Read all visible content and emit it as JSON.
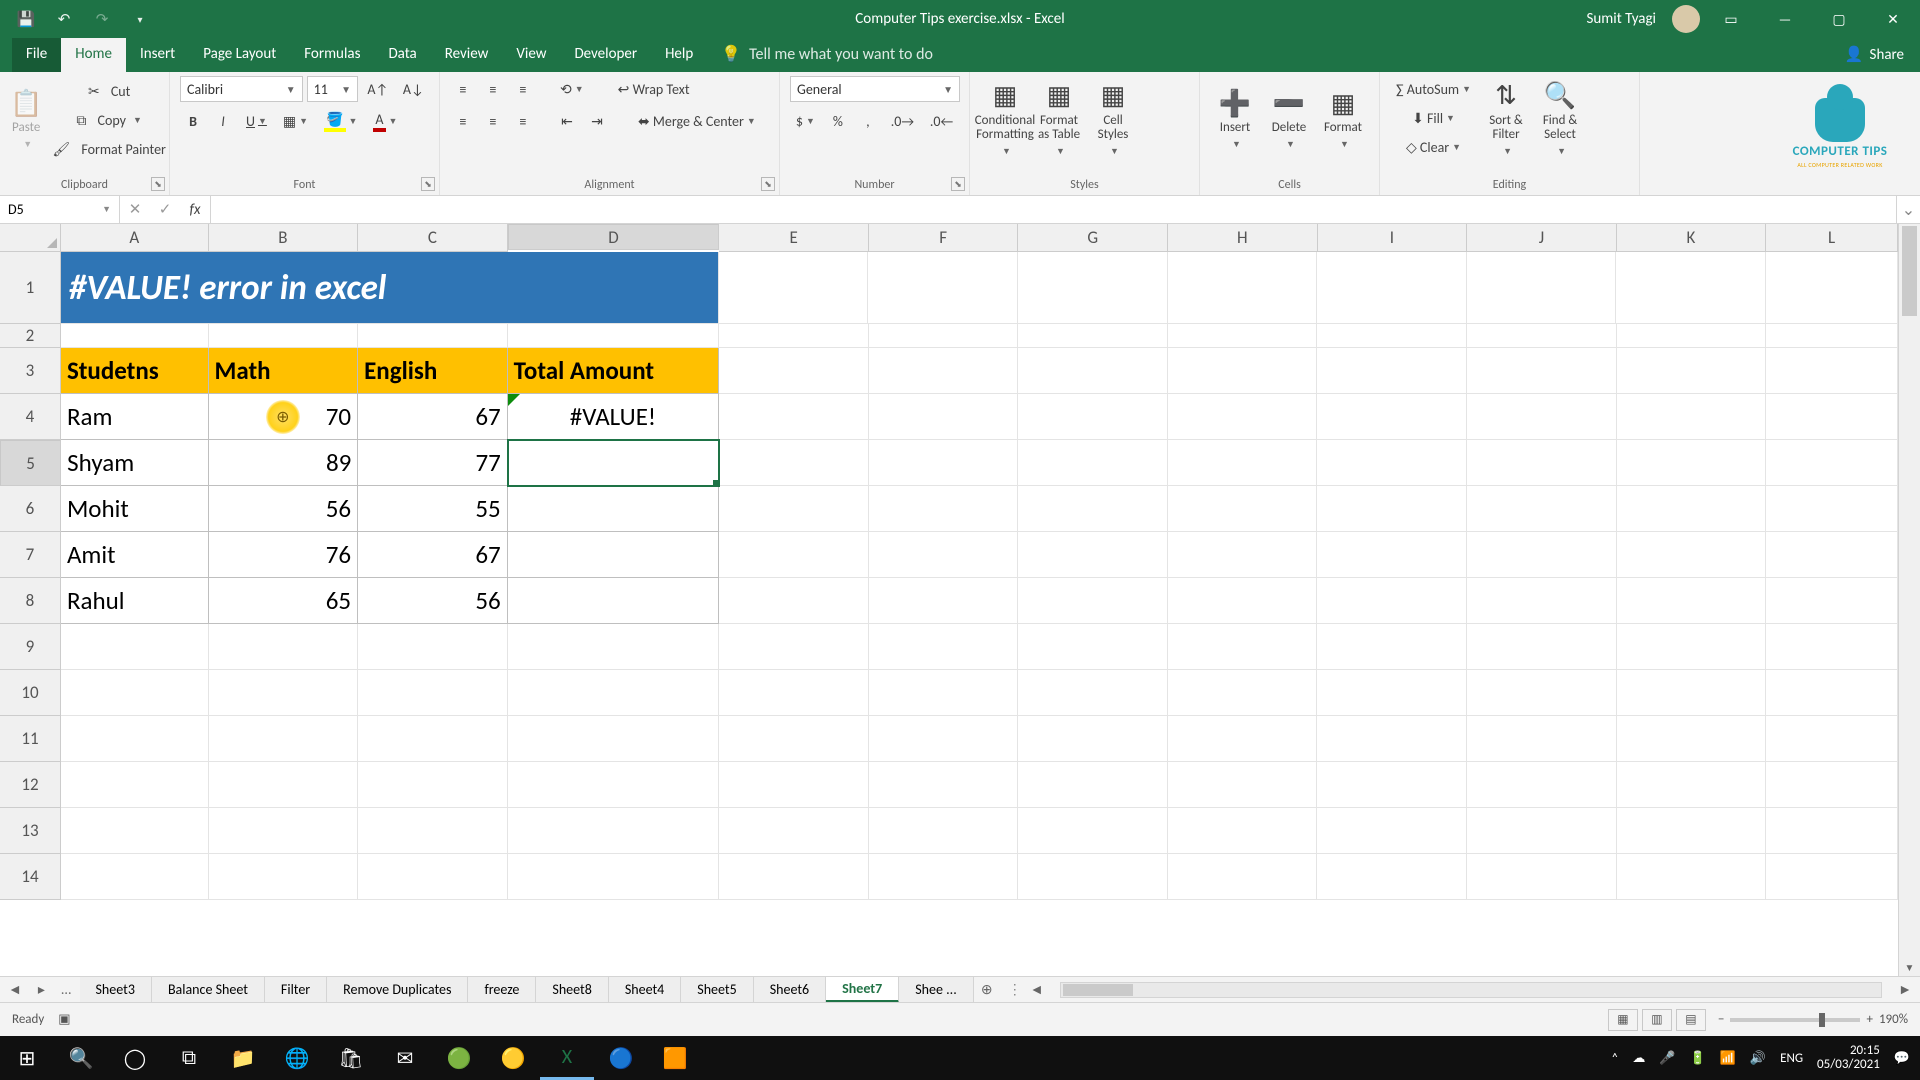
{
  "titlebar": {
    "doc_title": "Computer Tips exercise.xlsx - Excel",
    "user_name": "Sumit Tyagi"
  },
  "tabs": {
    "file": "File",
    "home": "Home",
    "insert": "Insert",
    "pagelayout": "Page Layout",
    "formulas": "Formulas",
    "data": "Data",
    "review": "Review",
    "view": "View",
    "developer": "Developer",
    "help": "Help",
    "tellme": "Tell me what you want to do",
    "share": "Share"
  },
  "ribbon": {
    "clipboard": {
      "paste": "Paste",
      "cut": "Cut",
      "copy": "Copy",
      "fmt": "Format Painter",
      "label": "Clipboard"
    },
    "font": {
      "name": "Calibri",
      "size": "11",
      "label": "Font"
    },
    "alignment": {
      "wrap": "Wrap Text",
      "merge": "Merge & Center",
      "label": "Alignment"
    },
    "number": {
      "fmt": "General",
      "label": "Number"
    },
    "styles": {
      "cond": "Conditional Formatting",
      "fat": "Format as Table",
      "cell": "Cell Styles",
      "label": "Styles"
    },
    "cells": {
      "ins": "Insert",
      "del": "Delete",
      "fmt": "Format",
      "label": "Cells"
    },
    "editing": {
      "sum": "AutoSum",
      "fill": "Fill",
      "clear": "Clear",
      "sort": "Sort & Filter",
      "find": "Find & Select",
      "label": "Editing"
    },
    "logo": {
      "line1": "COMPUTER TIPS",
      "line2": "ALL COMPUTER RELATED WORK"
    }
  },
  "fx": {
    "ref": "D5",
    "formula": ""
  },
  "cols": [
    "A",
    "B",
    "C",
    "D",
    "E",
    "F",
    "G",
    "H",
    "I",
    "J",
    "K",
    "L"
  ],
  "sheet": {
    "title": "#VALUE! error in excel",
    "headers": {
      "a": "Studetns",
      "b": "Math",
      "c": "English",
      "d": "Total Amount"
    },
    "rows": [
      {
        "a": "Ram",
        "b": "70",
        "c": "67",
        "d": "#VALUE!"
      },
      {
        "a": "Shyam",
        "b": "89",
        "c": "77",
        "d": ""
      },
      {
        "a": "Mohit",
        "b": "56",
        "c": "55",
        "d": ""
      },
      {
        "a": "Amit",
        "b": "76",
        "c": "67",
        "d": ""
      },
      {
        "a": "Rahul",
        "b": "65",
        "c": "56",
        "d": ""
      }
    ],
    "selected_col": "D",
    "selected_row": "5",
    "row_nums": [
      "1",
      "2",
      "3",
      "4",
      "5",
      "6",
      "7",
      "8",
      "9",
      "10",
      "11",
      "12",
      "13",
      "14"
    ]
  },
  "tabs_sheet": {
    "items": [
      "Sheet3",
      "Balance Sheet",
      "Filter",
      "Remove Duplicates",
      "freeze",
      "Sheet8",
      "Sheet4",
      "Sheet5",
      "Sheet6",
      "Sheet7",
      "Shee ..."
    ],
    "active": "Sheet7",
    "ell": "..."
  },
  "status": {
    "ready": "Ready",
    "zoom": "190%"
  },
  "tray": {
    "lang": "ENG",
    "time": "20:15",
    "date": "05/03/2021"
  }
}
